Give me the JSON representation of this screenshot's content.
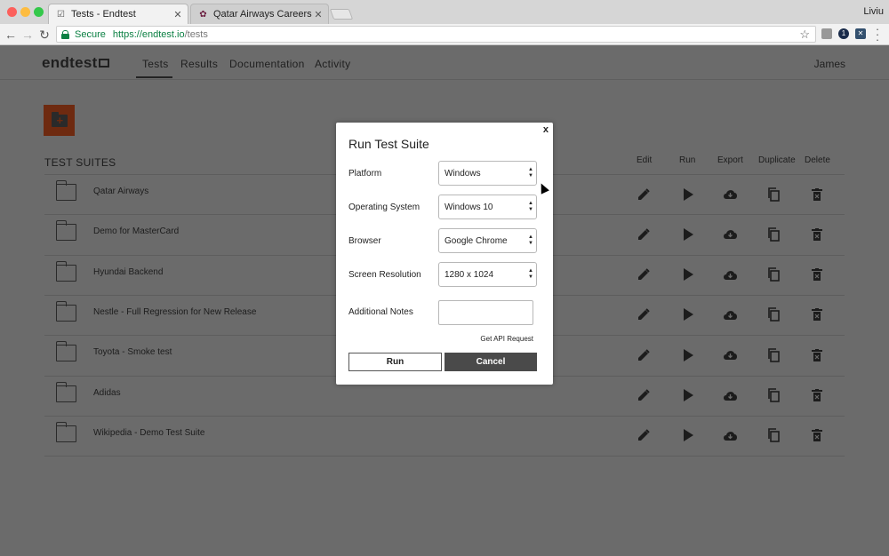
{
  "browser": {
    "tabs": [
      {
        "title": "Tests - Endtest",
        "active": true
      },
      {
        "title": "Qatar Airways Careers - Curre",
        "active": false
      }
    ],
    "profile_name": "Liviu",
    "address": {
      "secure_label": "Secure",
      "url_host": "https://endtest.io",
      "url_path": "/tests"
    },
    "extension_badge": "1"
  },
  "app": {
    "logo": "endtest",
    "nav": [
      "Tests",
      "Results",
      "Documentation",
      "Activity"
    ],
    "active_nav": "Tests",
    "user": "James"
  },
  "suites": {
    "heading": "TEST SUITES",
    "columns": [
      "Edit",
      "Run",
      "Export",
      "Duplicate",
      "Delete"
    ],
    "items": [
      "Qatar Airways",
      "Demo for MasterCard",
      "Hyundai Backend",
      "Nestle - Full Regression for New Release",
      "Toyota - Smoke test",
      "Adidas",
      "Wikipedia - Demo Test Suite"
    ]
  },
  "modal": {
    "title": "Run Test Suite",
    "close": "x",
    "fields": {
      "platform": {
        "label": "Platform",
        "value": "Windows"
      },
      "os": {
        "label": "Operating System",
        "value": "Windows 10"
      },
      "browser": {
        "label": "Browser",
        "value": "Google Chrome"
      },
      "resolution": {
        "label": "Screen Resolution",
        "value": "1280 x 1024"
      },
      "notes": {
        "label": "Additional Notes",
        "value": ""
      }
    },
    "api_link": "Get API Request",
    "run_label": "Run",
    "cancel_label": "Cancel"
  },
  "colors": {
    "overlay_bg": "#6b6b6b",
    "add_button": "#6e2a10",
    "secure_green": "#0b8043",
    "cancel_bg": "#4a4a4a"
  }
}
